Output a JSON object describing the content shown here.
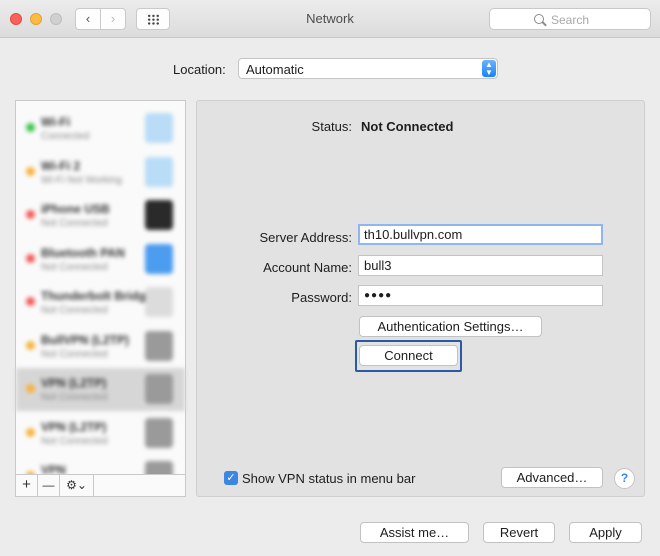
{
  "window": {
    "title": "Network"
  },
  "toolbar": {
    "back_glyph": "‹",
    "forward_glyph": "›",
    "search_placeholder": "Search"
  },
  "location": {
    "label": "Location:",
    "value": "Automatic"
  },
  "services": [
    {
      "name": "Wi-Fi",
      "sub": "Connected",
      "status_color": "#3cc34a",
      "icon": "wifi-icon",
      "icon_color": "#b9dcf7"
    },
    {
      "name": "Wi-Fi 2",
      "sub": "Wi-Fi Not Working",
      "status_color": "#f6b23a",
      "icon": "wifi-icon",
      "icon_color": "#b9dcf7"
    },
    {
      "name": "iPhone USB",
      "sub": "Not Connected",
      "status_color": "#f2595b",
      "icon": "phone-icon",
      "icon_color": "#2a2a2a"
    },
    {
      "name": "Bluetooth PAN",
      "sub": "Not Connected",
      "status_color": "#f2595b",
      "icon": "bluetooth-icon",
      "icon_color": "#4c9cf0"
    },
    {
      "name": "Thunderbolt Bridge",
      "sub": "Not Connected",
      "status_color": "#f2595b",
      "icon": "bridge-icon",
      "icon_color": "#dcdcdc"
    },
    {
      "name": "BullVPN (L2TP)",
      "sub": "Not Connected",
      "status_color": "#f6b23a",
      "icon": "lock-icon",
      "icon_color": "#9a9a9a"
    },
    {
      "name": "VPN (L2TP)",
      "sub": "Not Connected",
      "status_color": "#f6b23a",
      "icon": "lock-icon",
      "icon_color": "#9a9a9a",
      "selected": true
    },
    {
      "name": "VPN (L2TP)",
      "sub": "Not Connected",
      "status_color": "#f6b23a",
      "icon": "lock-icon",
      "icon_color": "#9a9a9a"
    },
    {
      "name": "VPN",
      "sub": "Not Connected",
      "status_color": "#f6b23a",
      "icon": "lock-icon",
      "icon_color": "#9a9a9a"
    }
  ],
  "sidebar_footer": {
    "add": "+",
    "remove": "—",
    "action": "⚙⌄"
  },
  "detail": {
    "status_label": "Status:",
    "status_value": "Not Connected",
    "server_label": "Server Address:",
    "server_value": "th10.bullvpn.com",
    "account_label": "Account Name:",
    "account_value": "bull3",
    "password_label": "Password:",
    "password_value": "●●●●",
    "auth_button": "Authentication Settings…",
    "connect_button": "Connect",
    "show_status_label": "Show VPN status in menu bar",
    "show_status_checked": true,
    "advanced_button": "Advanced…",
    "help": "?"
  },
  "footer": {
    "assist": "Assist me…",
    "revert": "Revert",
    "apply": "Apply"
  },
  "colors": {
    "accent": "#3b86e0",
    "connect_focus": "#2b59a8"
  }
}
